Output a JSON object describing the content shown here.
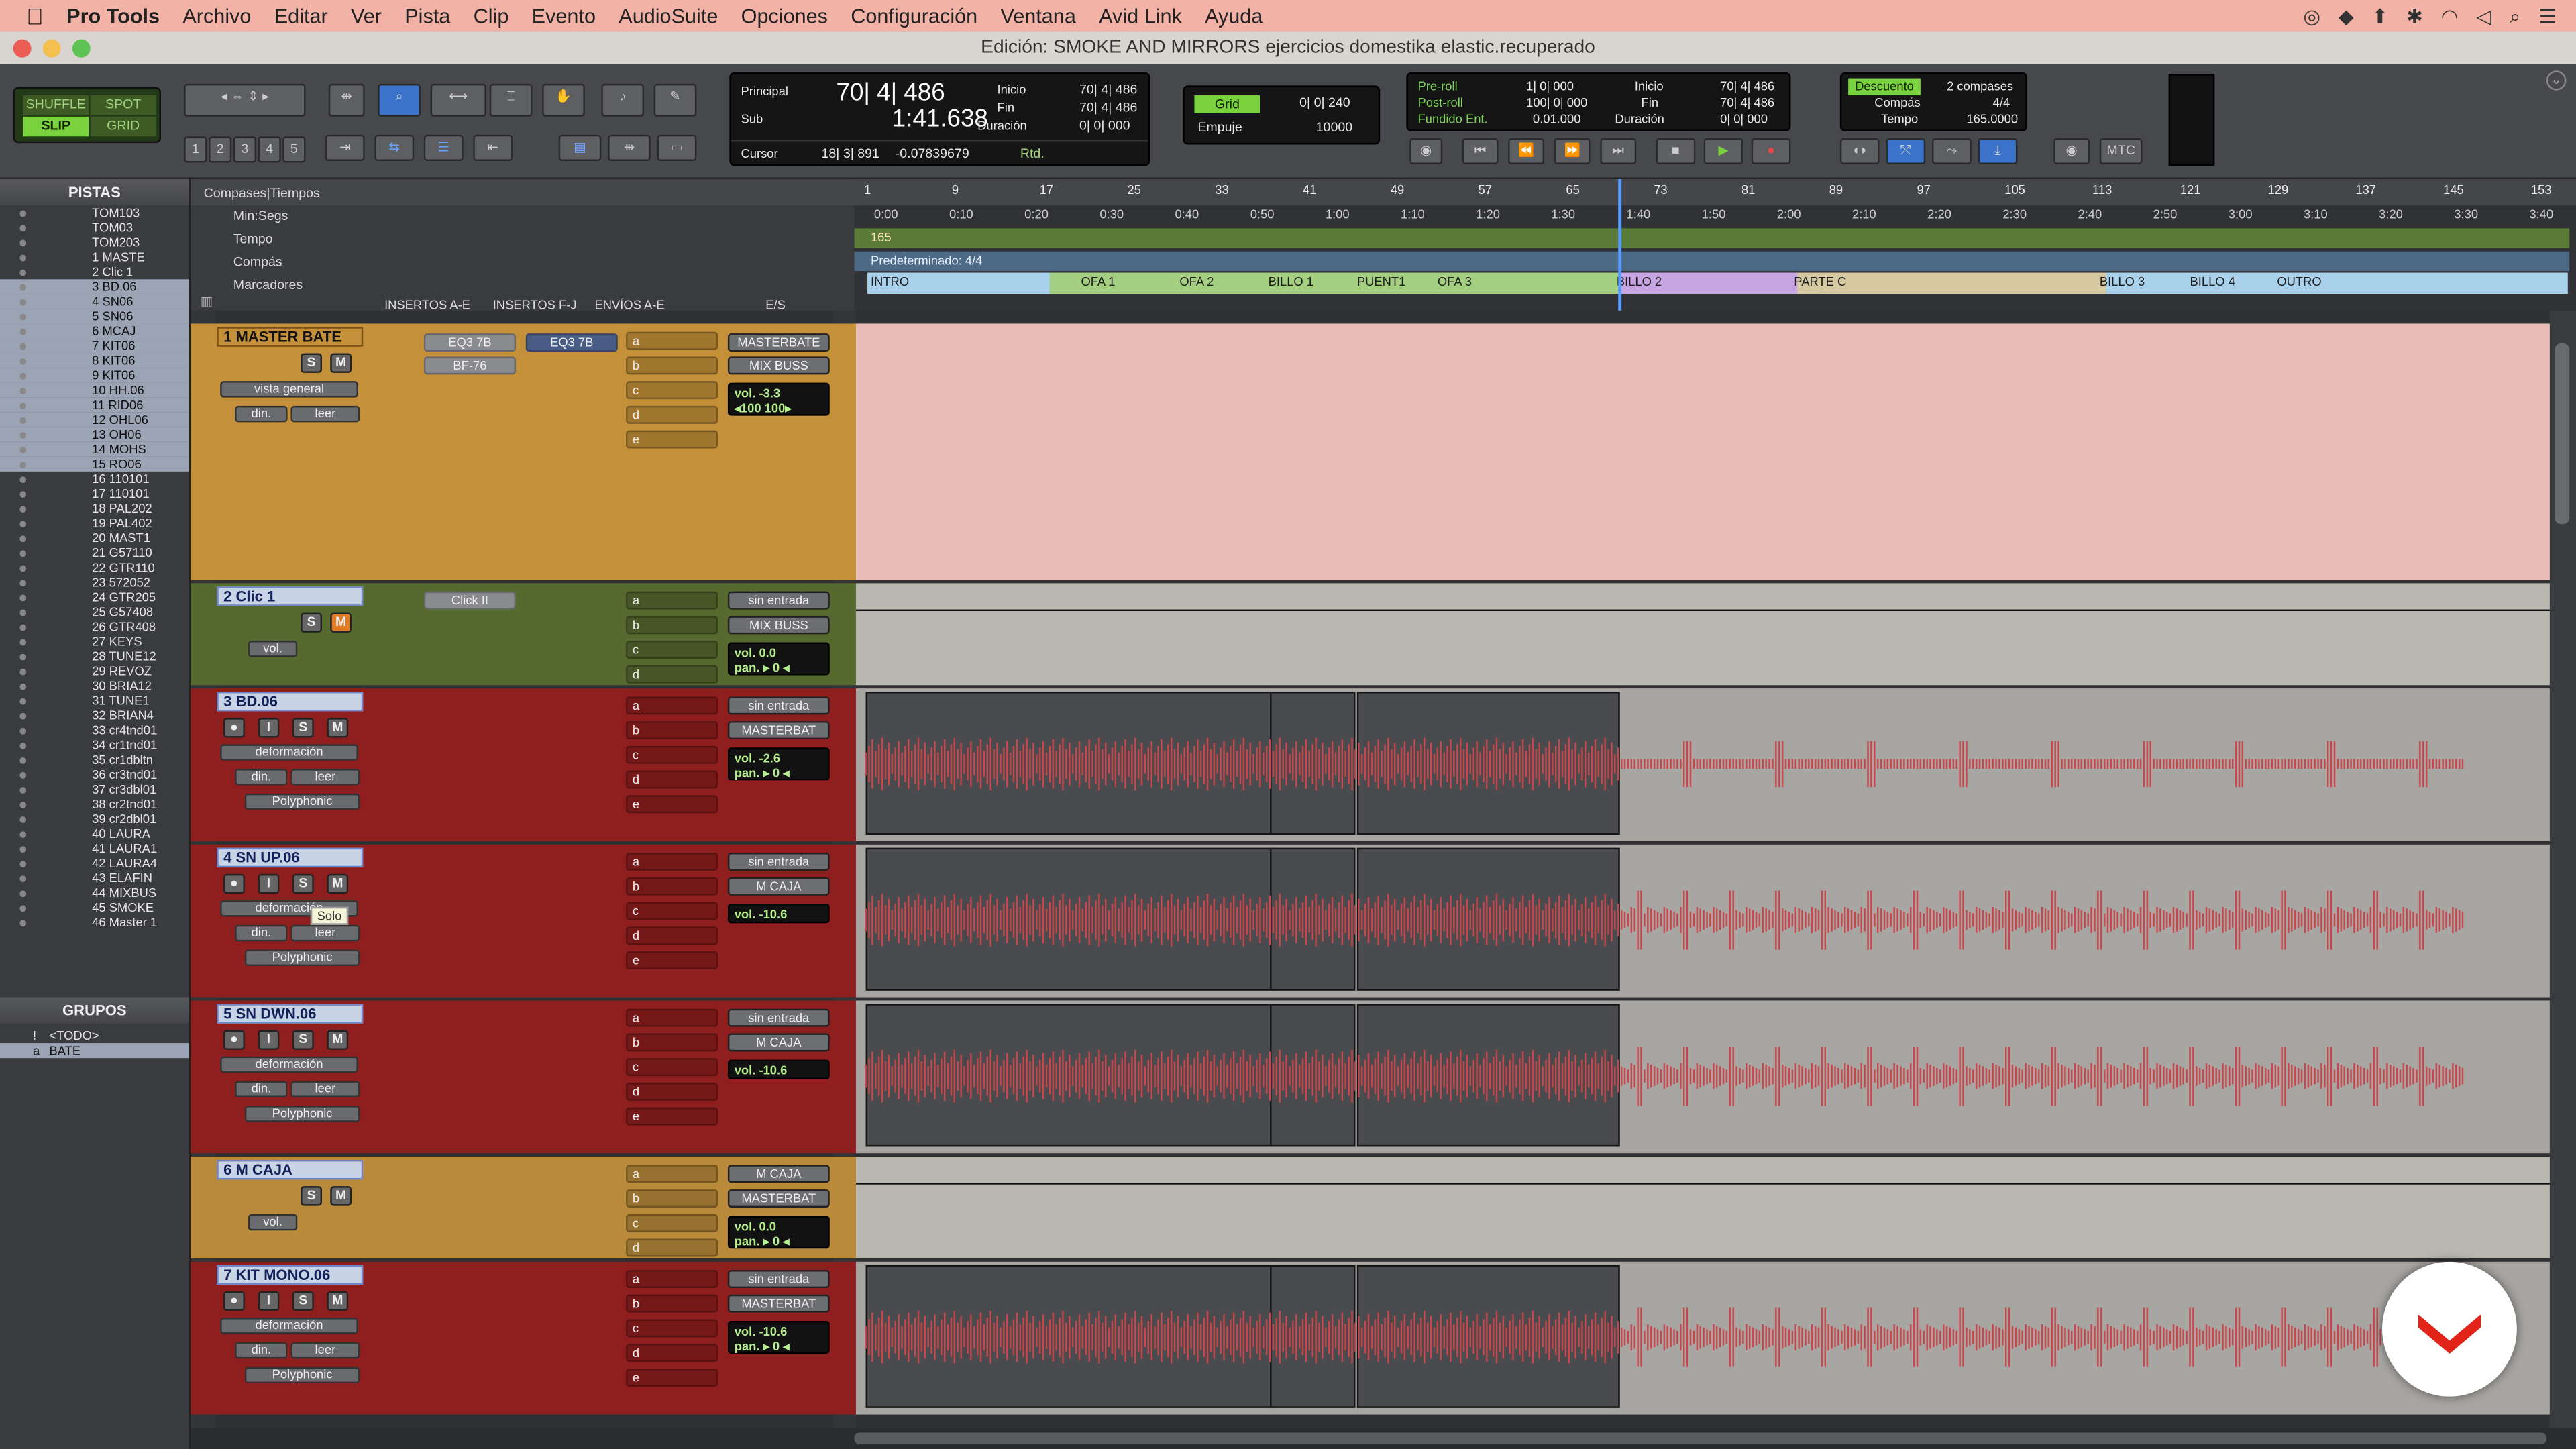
{
  "menubar": {
    "apple": "",
    "app": "Pro Tools",
    "items": [
      "Archivo",
      "Editar",
      "Ver",
      "Pista",
      "Clip",
      "Evento",
      "AudioSuite",
      "Opciones",
      "Configuración",
      "Ventana",
      "Avid Link",
      "Ayuda"
    ]
  },
  "window": {
    "title": "Edición: SMOKE AND MIRRORS ejercicios domestika elastic.recuperado"
  },
  "edit_modes": {
    "shuffle": "SHUFFLE",
    "spot": "SPOT",
    "slip": "SLIP",
    "grid": "GRID"
  },
  "zoom_presets": [
    "1",
    "2",
    "3",
    "4",
    "5"
  ],
  "counter": {
    "principal_label": "Principal",
    "principal": "70| 4| 486",
    "sub_label": "Sub",
    "sub": "1:41.638",
    "cursor_label": "Cursor",
    "cursor": "18| 3| 891",
    "sample": "-0.07839679",
    "inicio_label": "Inicio",
    "fin_label": "Fin",
    "duracion_label": "Duración",
    "inicio": "70| 4| 486",
    "fin": "70| 4| 486",
    "duracion": "0| 0| 000",
    "rtd": "Rtd."
  },
  "grid": {
    "grid_label": "Grid",
    "grid_value": "0| 0| 240",
    "nudge_label": "Empuje",
    "nudge_value": "10000"
  },
  "transport": {
    "preroll_label": "Pre-roll",
    "preroll": "1| 0| 000",
    "postroll_label": "Post-roll",
    "postroll": "100| 0| 000",
    "fade_label": "Fundido Ent.",
    "fade": "0.01.000",
    "inicio": "70| 4| 486",
    "fin": "70| 4| 486",
    "duracion": "0| 0| 000",
    "inicio_label": "Inicio",
    "fin_label": "Fin",
    "duracion_label": "Duración"
  },
  "countoff": {
    "descuento": "Descuento",
    "compases": "2 compases",
    "compas_label": "Compás",
    "compas": "4/4",
    "tempo_label": "Tempo",
    "tempo": "165.0000",
    "mtc": "MTC"
  },
  "tracks_panel": {
    "title": "PISTAS",
    "items": [
      "TOM103",
      "TOM03",
      "TOM203",
      "1  MASTE",
      "2  Clic 1",
      "3  BD.06",
      "4  SN06",
      "5  SN06",
      "6  MCAJ",
      "7  KIT06",
      "8  KIT06",
      "9  KIT06",
      "10  HH.06",
      "11  RID06",
      "12  OHL06",
      "13  OH06",
      "14  MOHS",
      "15  RO06",
      "16  110101",
      "17  110101",
      "18  PAL202",
      "19  PAL402",
      "20  MAST1",
      "21  G57110",
      "22  GTR110",
      "23  572052",
      "24  GTR205",
      "25  G57408",
      "26  GTR408",
      "27  KEYS",
      "28  TUNE12",
      "29  REVOZ",
      "30  BRIA12",
      "31  TUNE1",
      "32  BRIAN4",
      "33  cr4tnd01",
      "34  cr1tnd01",
      "35  cr1dbltn",
      "36  cr3tnd01",
      "37  cr3dbl01",
      "38  cr2tnd01",
      "39  cr2dbl01",
      "40  LAURA",
      "41  LAURA1",
      "42  LAURA4",
      "43  ELAFIN",
      "44  MIXBUS",
      "45  SMOKE",
      "46  Master 1"
    ]
  },
  "groups_panel": {
    "title": "GRUPOS",
    "items": [
      "<TODO>",
      "BATE"
    ],
    "item_letters": [
      "!",
      "a"
    ]
  },
  "column_headers": {
    "insertos_ae": "INSERTOS A-E",
    "insertos_fj": "INSERTOS F-J",
    "envios_ae": "ENVÍOS A-E",
    "es": "E/S"
  },
  "rulers": {
    "title": "Compases|Tiempos",
    "rows": [
      "Min:Segs",
      "Tempo",
      "Compás",
      "Marcadores"
    ],
    "tempo_value": "165",
    "meter": "Predeterminado: 4/4",
    "bars": [
      "1",
      "9",
      "17",
      "25",
      "33",
      "41",
      "49",
      "57",
      "65",
      "73",
      "81",
      "89",
      "97",
      "105",
      "113",
      "121",
      "129",
      "137",
      "145",
      "153"
    ],
    "times": [
      "0:00",
      "0:10",
      "0:20",
      "0:30",
      "0:40",
      "0:50",
      "1:00",
      "1:10",
      "1:20",
      "1:30",
      "1:40",
      "1:50",
      "2:00",
      "2:10",
      "2:20",
      "2:30",
      "2:40",
      "2:50",
      "3:00",
      "3:10",
      "3:20",
      "3:30",
      "3:40"
    ],
    "markers": [
      "INTRO",
      "OFA 1",
      "OFA 2",
      "BILLO 1",
      "PUENT1",
      "OFA 3",
      "BILLO 2",
      "PARTE C",
      "BILLO 3",
      "BILLO 4",
      "OUTRO"
    ]
  },
  "send_letters": [
    "a",
    "b",
    "c",
    "d",
    "e"
  ],
  "tracks": [
    {
      "name": "1  MASTER BATE",
      "view": "vista general",
      "auto": "din.",
      "mode": "leer",
      "inserts": [
        "EQ3 7B",
        "BF-76"
      ],
      "insert_fj": "EQ3 7B",
      "io": [
        "MASTERBATE",
        "MIX BUSS"
      ],
      "vol": "vol.  -3.3",
      "pan": "◂100    100▸"
    },
    {
      "name": "2  Clic 1",
      "auto": "vol.",
      "inserts": [
        "Click II"
      ],
      "io": [
        "sin entrada",
        "MIX BUSS"
      ],
      "vol": "vol.   0.0",
      "pan": "pan.  ▸ 0 ◂"
    },
    {
      "name": "3  BD.06",
      "view": "deformación",
      "auto": "din.",
      "mode": "leer",
      "plugin": "Polyphonic",
      "io": [
        "sin entrada",
        "MASTERBAT"
      ],
      "vol": "vol.  -2.6",
      "pan": "pan.  ▸ 0 ◂"
    },
    {
      "name": "4  SN UP.06",
      "view": "deformación",
      "auto": "din.",
      "mode": "leer",
      "plugin": "Polyphonic",
      "io": [
        "sin entrada",
        "M CAJA"
      ],
      "vol": "vol.  -10.6",
      "tooltip": "Solo"
    },
    {
      "name": "5  SN DWN.06",
      "view": "deformación",
      "auto": "din.",
      "mode": "leer",
      "plugin": "Polyphonic",
      "io": [
        "sin entrada",
        "M CAJA"
      ],
      "vol": "vol.  -10.6"
    },
    {
      "name": "6  M CAJA",
      "auto": "vol.",
      "io": [
        "M CAJA",
        "MASTERBAT"
      ],
      "vol": "vol.   0.0",
      "pan": "pan.  ▸ 0 ◂"
    },
    {
      "name": "7  KIT MONO.06",
      "view": "deformación",
      "auto": "din.",
      "mode": "leer",
      "plugin": "Polyphonic",
      "io": [
        "sin entrada",
        "MASTERBAT"
      ],
      "vol": "vol.  -10.6",
      "pan": "pan.  ▸ 0 ◂"
    }
  ],
  "record_buttons": {
    "s": "S",
    "m": "M",
    "i": "I"
  },
  "colors": {
    "menubar": "#f3b2a6",
    "master_track": "#c4913a",
    "click_track": "#566a30",
    "audio_track": "#8f1e1e",
    "aux_track": "#b98a3a",
    "waveform": "#c7474d",
    "accent_blue": "#6d85c9"
  }
}
